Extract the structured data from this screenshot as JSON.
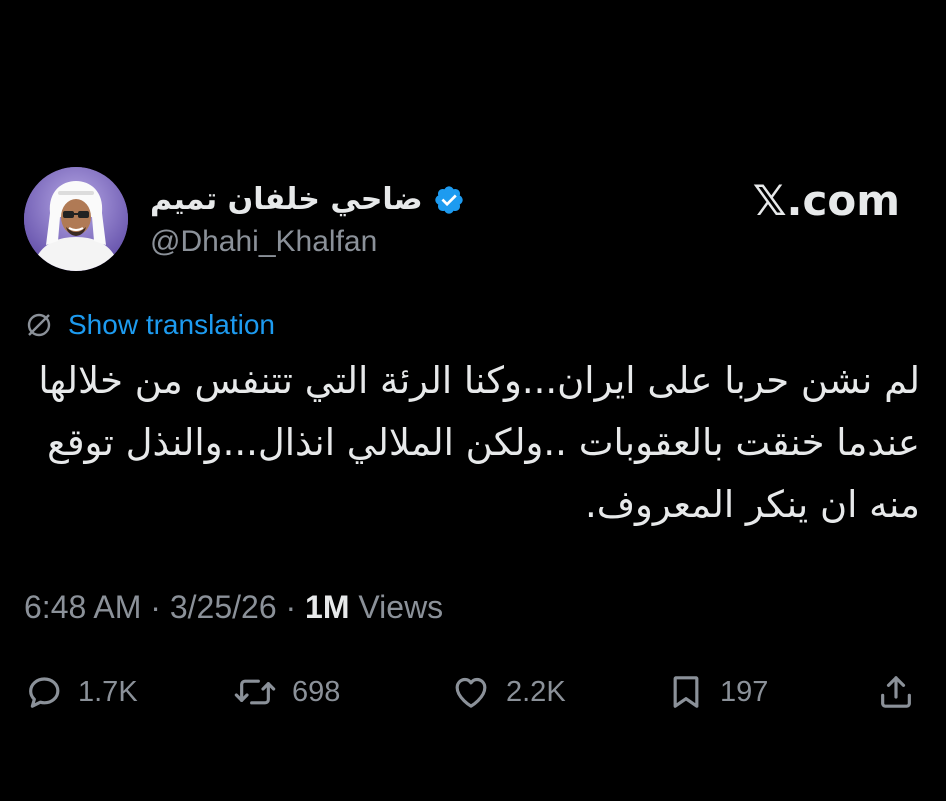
{
  "author": {
    "display_name": "ضاحي خلفان تميم",
    "handle": "@Dhahi_Khalfan",
    "verified": true,
    "avatar_icon": "profile-photo"
  },
  "brand": {
    "logo_text": "𝕏.com"
  },
  "translation": {
    "label": "Show translation",
    "icon": "translate-globe-icon",
    "color": "#1d9bf0"
  },
  "tweet": {
    "text": "لم نشن حربا على ايران...وكنا الرئة التي تتنفس من خلالها عندما خنقت بالعقوبات ..ولكن الملالي انذال...والنذل توقع منه ان ينكر المعروف."
  },
  "meta": {
    "time": "6:48 AM",
    "date": "3/25/26",
    "separator": "·",
    "views_count": "1M",
    "views_label": "Views"
  },
  "actions": {
    "replies": "1.7K",
    "reposts": "698",
    "likes": "2.2K",
    "bookmarks": "197"
  },
  "colors": {
    "background": "#000000",
    "text": "#e7e9ea",
    "muted": "#8b9199",
    "accent": "#1d9bf0"
  }
}
